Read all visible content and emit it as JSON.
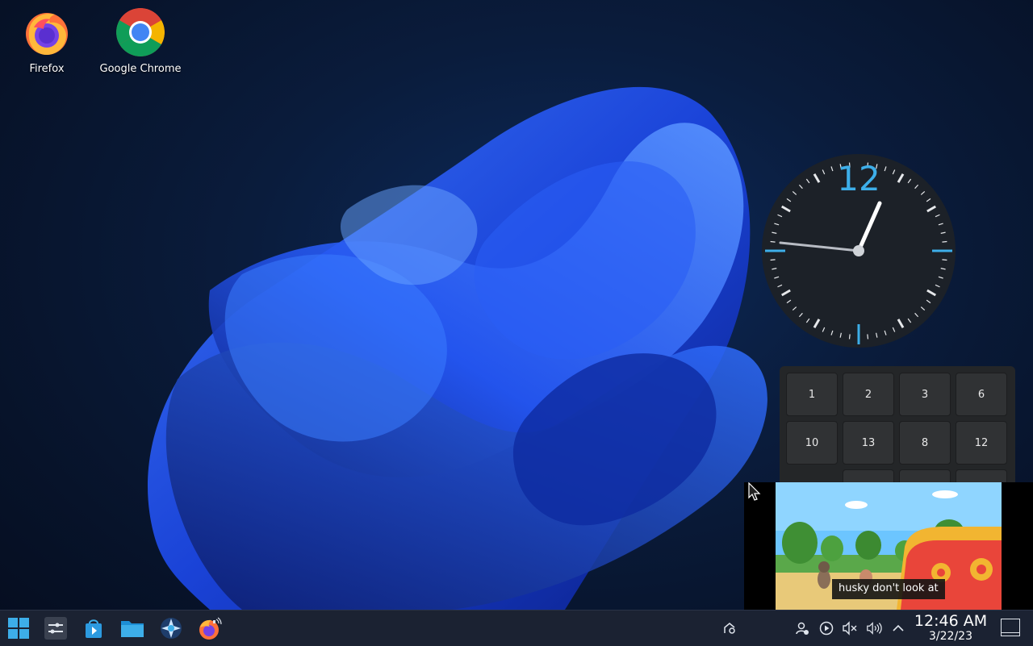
{
  "desktop": {
    "icons": [
      {
        "label": "Firefox",
        "icon": "firefox-icon"
      },
      {
        "label": "Google Chrome",
        "icon": "chrome-icon"
      }
    ]
  },
  "clock_widget": {
    "twelve_label": "12"
  },
  "puzzle_widget": {
    "tiles": [
      "1",
      "2",
      "3",
      "6",
      "10",
      "13",
      "8",
      "12"
    ]
  },
  "pip_player": {
    "caption": "husky don't look at"
  },
  "taskbar": {
    "apps": [
      {
        "name": "start-menu",
        "icon": "windows-logo-icon"
      },
      {
        "name": "system-settings",
        "icon": "settings-sliders-icon"
      },
      {
        "name": "discover-store",
        "icon": "store-bag-icon"
      },
      {
        "name": "file-manager",
        "icon": "folder-icon"
      },
      {
        "name": "kde-connect",
        "icon": "kde-star-icon"
      },
      {
        "name": "firefox",
        "icon": "firefox-icon"
      }
    ],
    "tray": {
      "icons": [
        "kde-connect-tray-icon",
        "user-status-icon",
        "media-play-icon",
        "volume-muted-icon",
        "volume-icon",
        "expand-tray-icon"
      ]
    },
    "time": "12:46 AM",
    "date": "3/22/23"
  },
  "colors": {
    "accent": "#3daee9",
    "taskbar": "#1b2232"
  }
}
